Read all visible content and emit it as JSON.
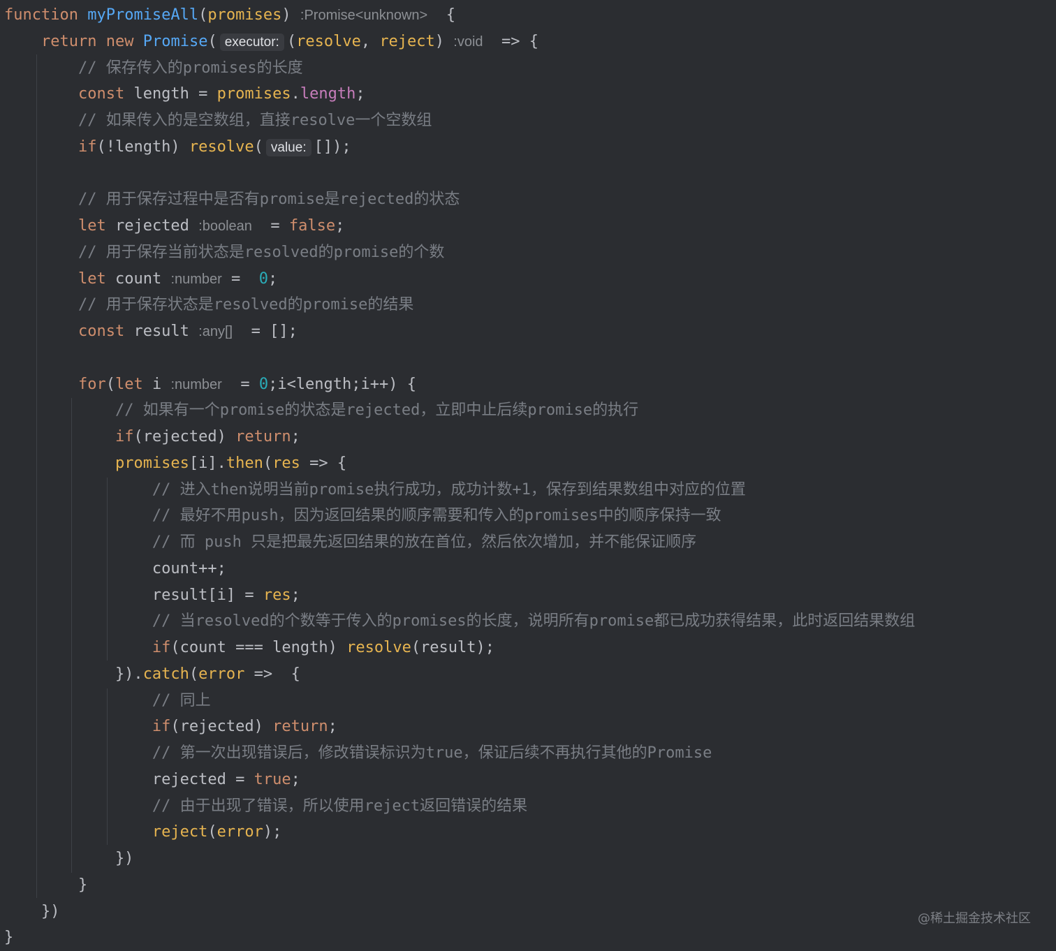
{
  "editor": {
    "lines": [
      [
        {
          "t": "function",
          "c": "kw"
        },
        {
          "t": " "
        },
        {
          "t": "myPromiseAll",
          "c": "fn"
        },
        {
          "t": "("
        },
        {
          "t": "promises",
          "c": "param"
        },
        {
          "t": ") "
        },
        {
          "t": ":Promise<unknown>",
          "c": "hint"
        },
        {
          "t": "  {"
        }
      ],
      [
        {
          "t": "    "
        },
        {
          "t": "return",
          "c": "kw"
        },
        {
          "t": " "
        },
        {
          "t": "new",
          "c": "kw"
        },
        {
          "t": " "
        },
        {
          "t": "Promise",
          "c": "fn"
        },
        {
          "t": "("
        },
        {
          "t": "executor:",
          "c": "hint-box"
        },
        {
          "t": "("
        },
        {
          "t": "resolve",
          "c": "param"
        },
        {
          "t": ", "
        },
        {
          "t": "reject",
          "c": "param"
        },
        {
          "t": ") "
        },
        {
          "t": ":void",
          "c": "hint"
        },
        {
          "t": "  => {"
        }
      ],
      [
        {
          "t": "        "
        },
        {
          "t": "// 保存传入的promises的长度",
          "c": "cm"
        }
      ],
      [
        {
          "t": "        "
        },
        {
          "t": "const",
          "c": "kw"
        },
        {
          "t": " length = "
        },
        {
          "t": "promises",
          "c": "param"
        },
        {
          "t": "."
        },
        {
          "t": "length",
          "c": "prop"
        },
        {
          "t": ";"
        }
      ],
      [
        {
          "t": "        "
        },
        {
          "t": "// 如果传入的是空数组，直接resolve一个空数组",
          "c": "cm"
        }
      ],
      [
        {
          "t": "        "
        },
        {
          "t": "if",
          "c": "kw"
        },
        {
          "t": "(!length) "
        },
        {
          "t": "resolve",
          "c": "param"
        },
        {
          "t": "("
        },
        {
          "t": "value:",
          "c": "hint-box"
        },
        {
          "t": "[]);"
        }
      ],
      [],
      [
        {
          "t": "        "
        },
        {
          "t": "// 用于保存过程中是否有promise是rejected的状态",
          "c": "cm"
        }
      ],
      [
        {
          "t": "        "
        },
        {
          "t": "let",
          "c": "kw"
        },
        {
          "t": " rejected "
        },
        {
          "t": ":boolean",
          "c": "hint"
        },
        {
          "t": "  = "
        },
        {
          "t": "false",
          "c": "kw"
        },
        {
          "t": ";"
        }
      ],
      [
        {
          "t": "        "
        },
        {
          "t": "// 用于保存当前状态是resolved的promise的个数",
          "c": "cm"
        }
      ],
      [
        {
          "t": "        "
        },
        {
          "t": "let",
          "c": "kw"
        },
        {
          "t": " count "
        },
        {
          "t": ":number",
          "c": "hint"
        },
        {
          "t": " =  "
        },
        {
          "t": "0",
          "c": "num"
        },
        {
          "t": ";"
        }
      ],
      [
        {
          "t": "        "
        },
        {
          "t": "// 用于保存状态是resolved的promise的结果",
          "c": "cm"
        }
      ],
      [
        {
          "t": "        "
        },
        {
          "t": "const",
          "c": "kw"
        },
        {
          "t": " result "
        },
        {
          "t": ":any[]",
          "c": "hint"
        },
        {
          "t": "  = [];"
        }
      ],
      [],
      [
        {
          "t": "        "
        },
        {
          "t": "for",
          "c": "kw"
        },
        {
          "t": "("
        },
        {
          "t": "let",
          "c": "kw"
        },
        {
          "t": " i "
        },
        {
          "t": ":number",
          "c": "hint"
        },
        {
          "t": "  = "
        },
        {
          "t": "0",
          "c": "num"
        },
        {
          "t": ";i<length;i++) {"
        }
      ],
      [
        {
          "t": "            "
        },
        {
          "t": "// 如果有一个promise的状态是rejected，立即中止后续promise的执行",
          "c": "cm"
        }
      ],
      [
        {
          "t": "            "
        },
        {
          "t": "if",
          "c": "kw"
        },
        {
          "t": "(rejected) "
        },
        {
          "t": "return",
          "c": "kw"
        },
        {
          "t": ";"
        }
      ],
      [
        {
          "t": "            "
        },
        {
          "t": "promises",
          "c": "param"
        },
        {
          "t": "[i]."
        },
        {
          "t": "then",
          "c": "param"
        },
        {
          "t": "("
        },
        {
          "t": "res",
          "c": "param"
        },
        {
          "t": " => {"
        }
      ],
      [
        {
          "t": "                "
        },
        {
          "t": "// 进入then说明当前promise执行成功，成功计数+1，保存到结果数组中对应的位置",
          "c": "cm"
        }
      ],
      [
        {
          "t": "                "
        },
        {
          "t": "// 最好不用push，因为返回结果的顺序需要和传入的promises中的顺序保持一致",
          "c": "cm"
        }
      ],
      [
        {
          "t": "                "
        },
        {
          "t": "// 而 push 只是把最先返回结果的放在首位，然后依次增加，并不能保证顺序",
          "c": "cm"
        }
      ],
      [
        {
          "t": "                count++;"
        }
      ],
      [
        {
          "t": "                result[i] = "
        },
        {
          "t": "res",
          "c": "param"
        },
        {
          "t": ";"
        }
      ],
      [
        {
          "t": "                "
        },
        {
          "t": "// 当resolved的个数等于传入的promises的长度，说明所有promise都已成功获得结果，此时返回结果数组",
          "c": "cm"
        }
      ],
      [
        {
          "t": "                "
        },
        {
          "t": "if",
          "c": "kw"
        },
        {
          "t": "(count === length) "
        },
        {
          "t": "resolve",
          "c": "param"
        },
        {
          "t": "(result);"
        }
      ],
      [
        {
          "t": "            })."
        },
        {
          "t": "catch",
          "c": "param"
        },
        {
          "t": "("
        },
        {
          "t": "error",
          "c": "param"
        },
        {
          "t": " =>  {"
        }
      ],
      [
        {
          "t": "                "
        },
        {
          "t": "// 同上",
          "c": "cm"
        }
      ],
      [
        {
          "t": "                "
        },
        {
          "t": "if",
          "c": "kw"
        },
        {
          "t": "(rejected) "
        },
        {
          "t": "return",
          "c": "kw"
        },
        {
          "t": ";"
        }
      ],
      [
        {
          "t": "                "
        },
        {
          "t": "// 第一次出现错误后，修改错误标识为true，保证后续不再执行其他的Promise",
          "c": "cm"
        }
      ],
      [
        {
          "t": "                rejected = "
        },
        {
          "t": "true",
          "c": "kw"
        },
        {
          "t": ";"
        }
      ],
      [
        {
          "t": "                "
        },
        {
          "t": "// 由于出现了错误，所以使用reject返回错误的结果",
          "c": "cm"
        }
      ],
      [
        {
          "t": "                "
        },
        {
          "t": "reject",
          "c": "param"
        },
        {
          "t": "("
        },
        {
          "t": "error",
          "c": "param"
        },
        {
          "t": ");"
        }
      ],
      [
        {
          "t": "            })"
        }
      ],
      [
        {
          "t": "        }"
        }
      ],
      [
        {
          "t": "    })"
        }
      ],
      [
        {
          "t": "}"
        }
      ]
    ]
  },
  "watermark": "@稀土掘金技术社区"
}
